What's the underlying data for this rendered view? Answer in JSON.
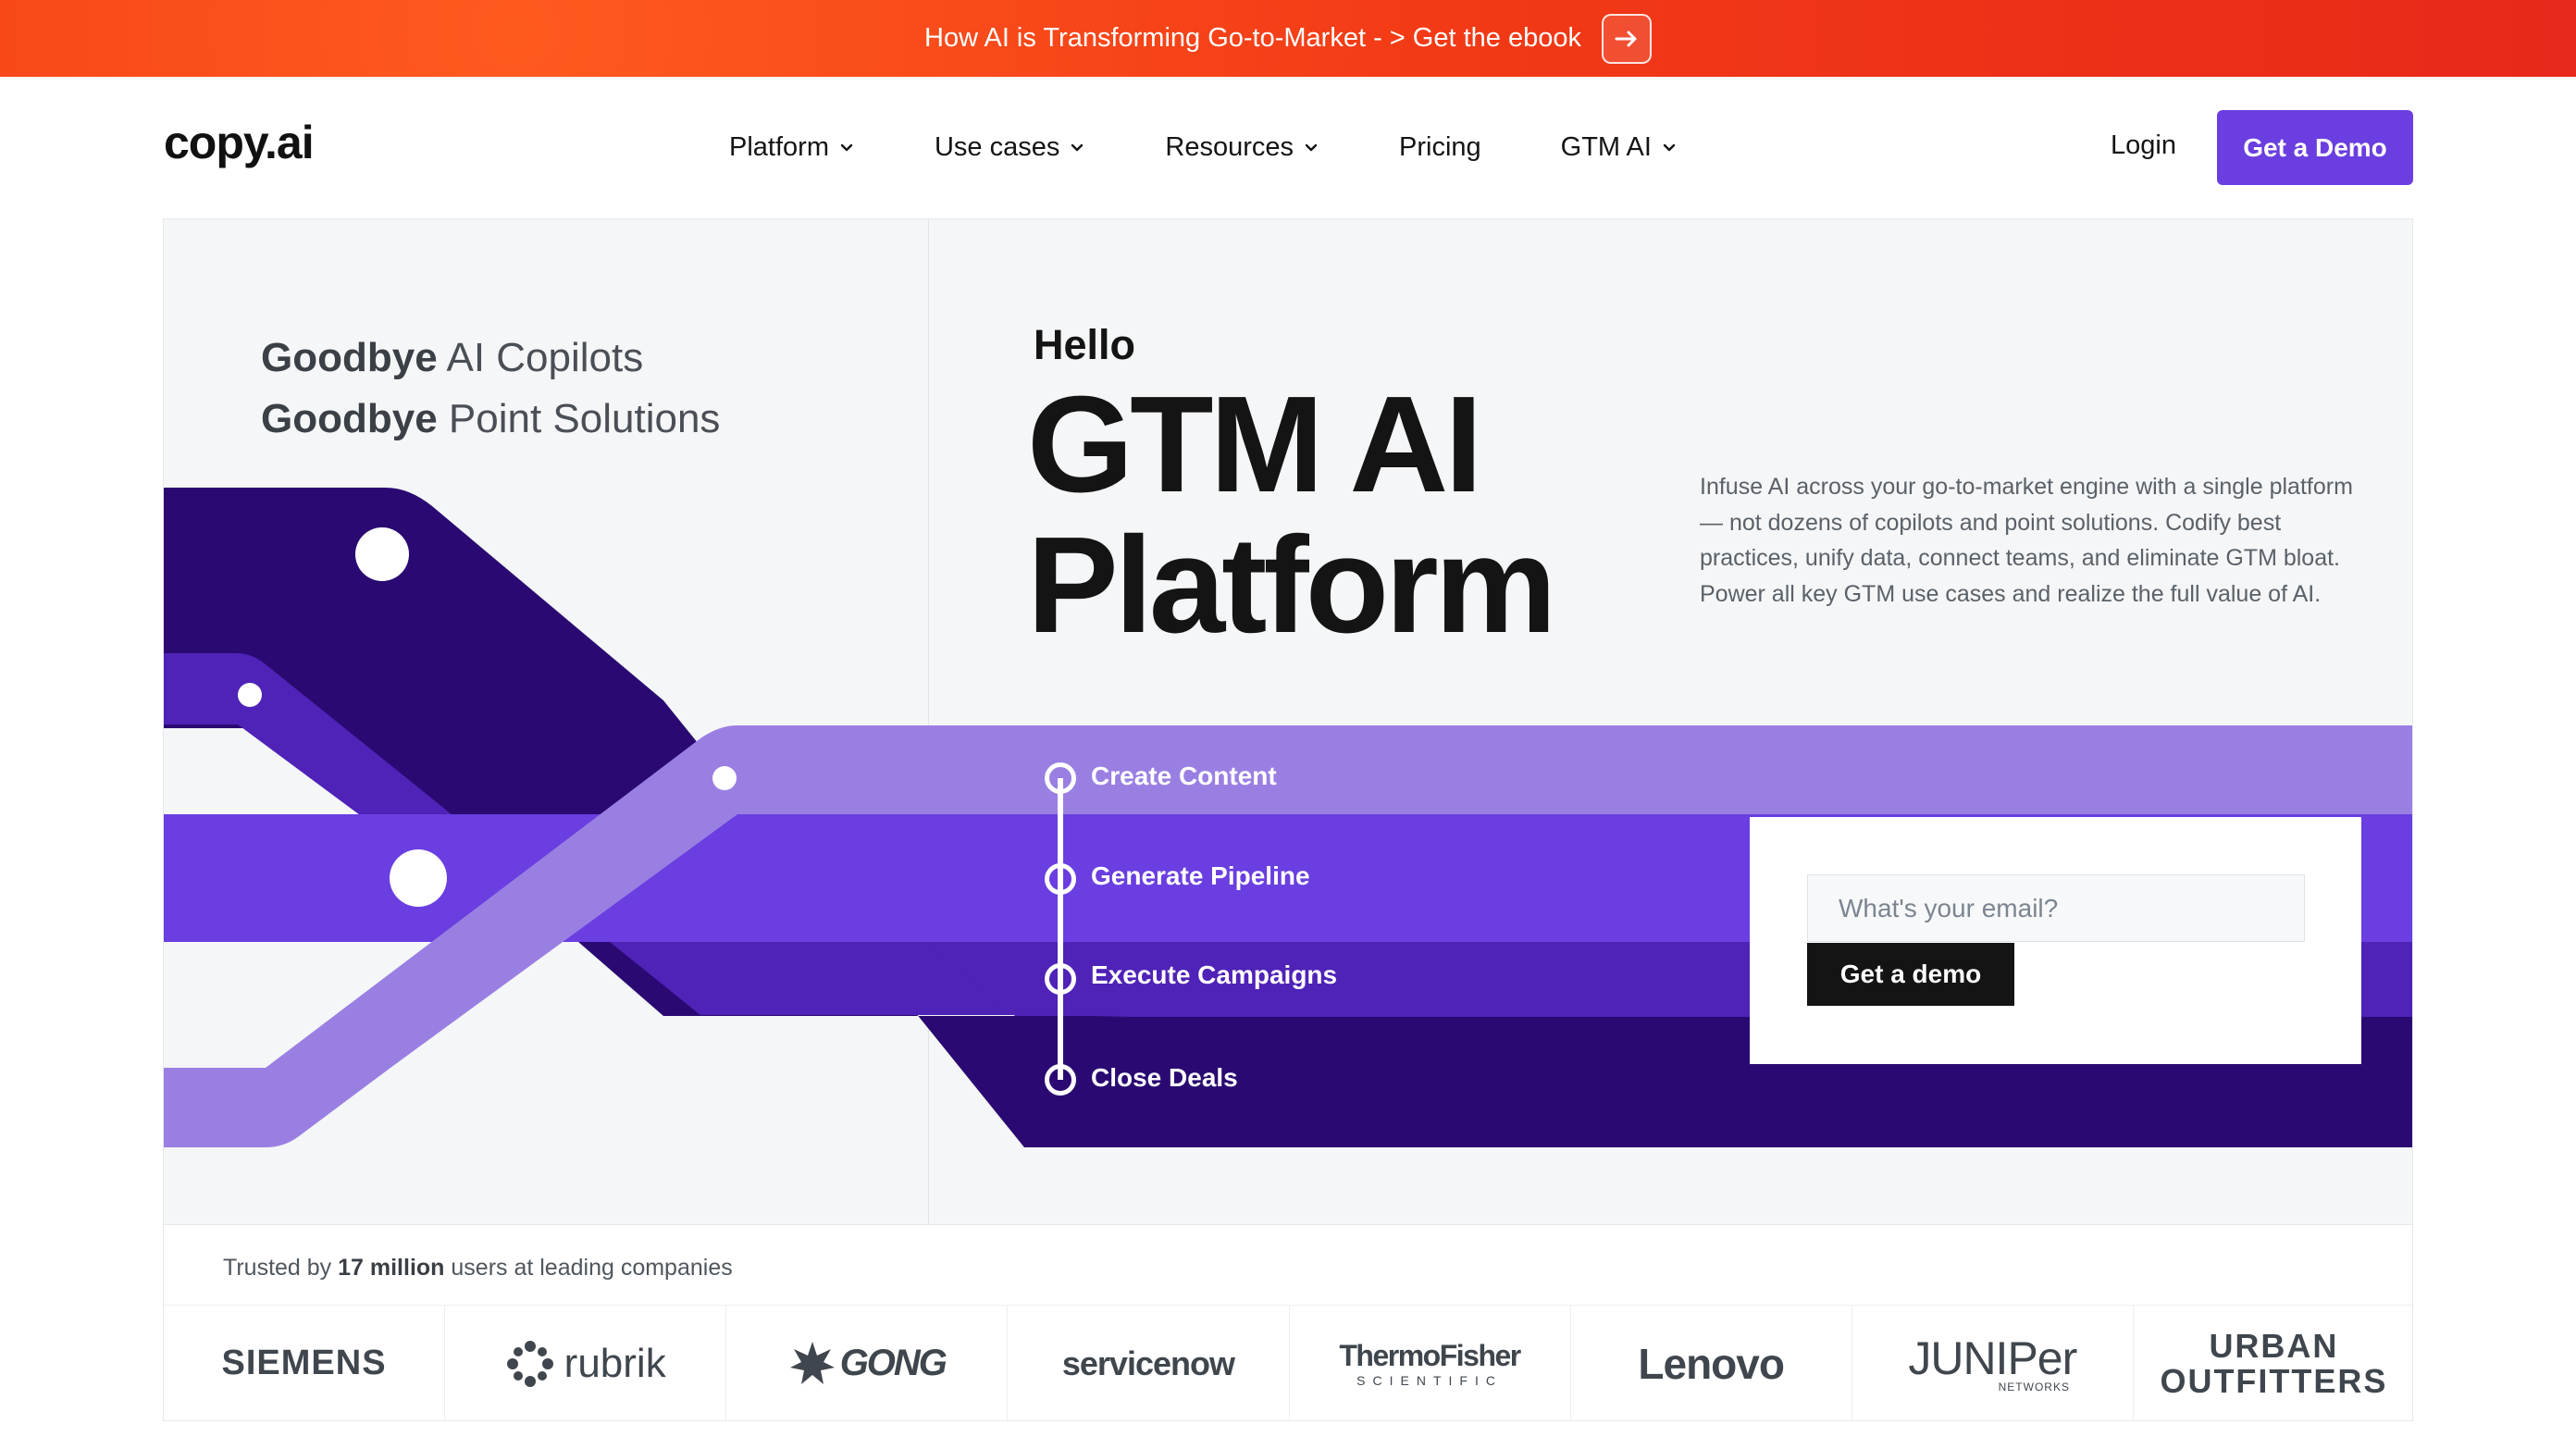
{
  "announcement": {
    "text": "How AI is Transforming Go-to-Market - > Get the ebook",
    "icon": "arrow-right-icon"
  },
  "nav": {
    "logo": "copy.ai",
    "menu": [
      {
        "label": "Platform",
        "dropdown": true
      },
      {
        "label": "Use cases",
        "dropdown": true
      },
      {
        "label": "Resources",
        "dropdown": true
      },
      {
        "label": "Pricing",
        "dropdown": false
      },
      {
        "label": "GTM AI",
        "dropdown": true
      }
    ],
    "login": "Login",
    "cta": "Get a Demo"
  },
  "hero": {
    "goodbye_lines": [
      {
        "bold": "Goodbye",
        "rest": " AI Copilots"
      },
      {
        "bold": "Goodbye",
        "rest": " Point Solutions"
      }
    ],
    "hello": "Hello",
    "headline_line1": "GTM AI",
    "headline_line2": "Platform",
    "description": "Infuse AI across your go-to-market engine with a single platform — not dozens of copilots and point solutions. Codify best practices, unify data, connect teams, and eliminate GTM bloat. Power all key GTM use cases and realize the full value of AI.",
    "steps": [
      "Create Content",
      "Generate Pipeline",
      "Execute Campaigns",
      "Close Deals"
    ],
    "form": {
      "email_placeholder": "What's your email?",
      "submit": "Get a demo"
    }
  },
  "trusted": {
    "prefix": "Trusted by ",
    "count": "17 million",
    "suffix": " users at leading companies",
    "logos": [
      "SIEMENS",
      "rubrik",
      "GONG",
      "servicenow",
      "ThermoFisher",
      "SCIENTIFIC",
      "Lenovo",
      "JUNIPer",
      "NETWORKS",
      "URBAN",
      "OUTFITTERS"
    ]
  },
  "colors": {
    "brand_purple": "#6a3ee0",
    "deep_purple": "#2a0a72",
    "mid_purple": "#4f22b8",
    "light_purple": "#9a7fe3",
    "banner_orange": "#f23a16"
  }
}
